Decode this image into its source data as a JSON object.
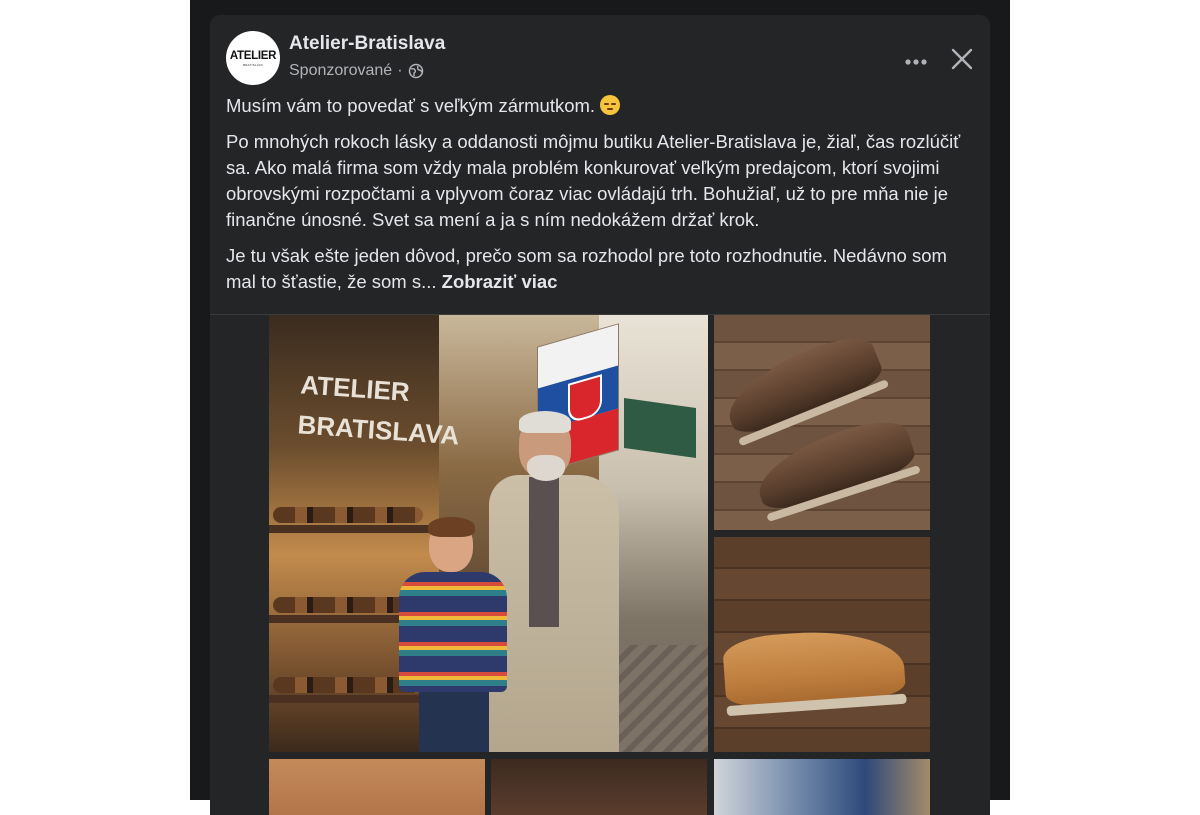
{
  "post": {
    "page_name": "Atelier-Bratislava",
    "avatar_text": "ATELIER",
    "avatar_subtext": "BRATISLAVA",
    "sponsored_label": "Sponzorované",
    "separator": "·",
    "more_label": "•••",
    "close_label": "✕",
    "paragraphs": [
      "Musím vám to povedať s veľkým zármutkom.",
      "Po mnohých rokoch lásky a oddanosti môjmu butiku Atelier-Bratislava je, žiaľ, čas rozlúčiť sa. Ako malá firma som vždy mala problém konkurovať veľkým predajcom, ktorí svojimi obrovskými rozpočtami a vplyvom čoraz viac ovládajú trh. Bohužiaľ, už to pre mňa nie je finančne únosné. Svet sa mení a ja s ním nedokážem držať krok.",
      "Je tu však ešte jeden dôvod, prečo som sa rozhodol pre toto rozhodnutie. Nedávno som mal to šťastie, že som s..."
    ],
    "see_more_label": "Zobraziť viac",
    "shop_sign_line1": "ATELIER",
    "shop_sign_line2": "BRATISLAVA"
  },
  "colors": {
    "background": "#18191a",
    "card": "#242526",
    "text_primary": "#e4e6eb",
    "text_secondary": "#b0b3b8"
  },
  "icons": {
    "more": "ellipsis-icon",
    "close": "close-icon",
    "audience": "globe-icon",
    "emoji": "pensive-face-emoji"
  }
}
